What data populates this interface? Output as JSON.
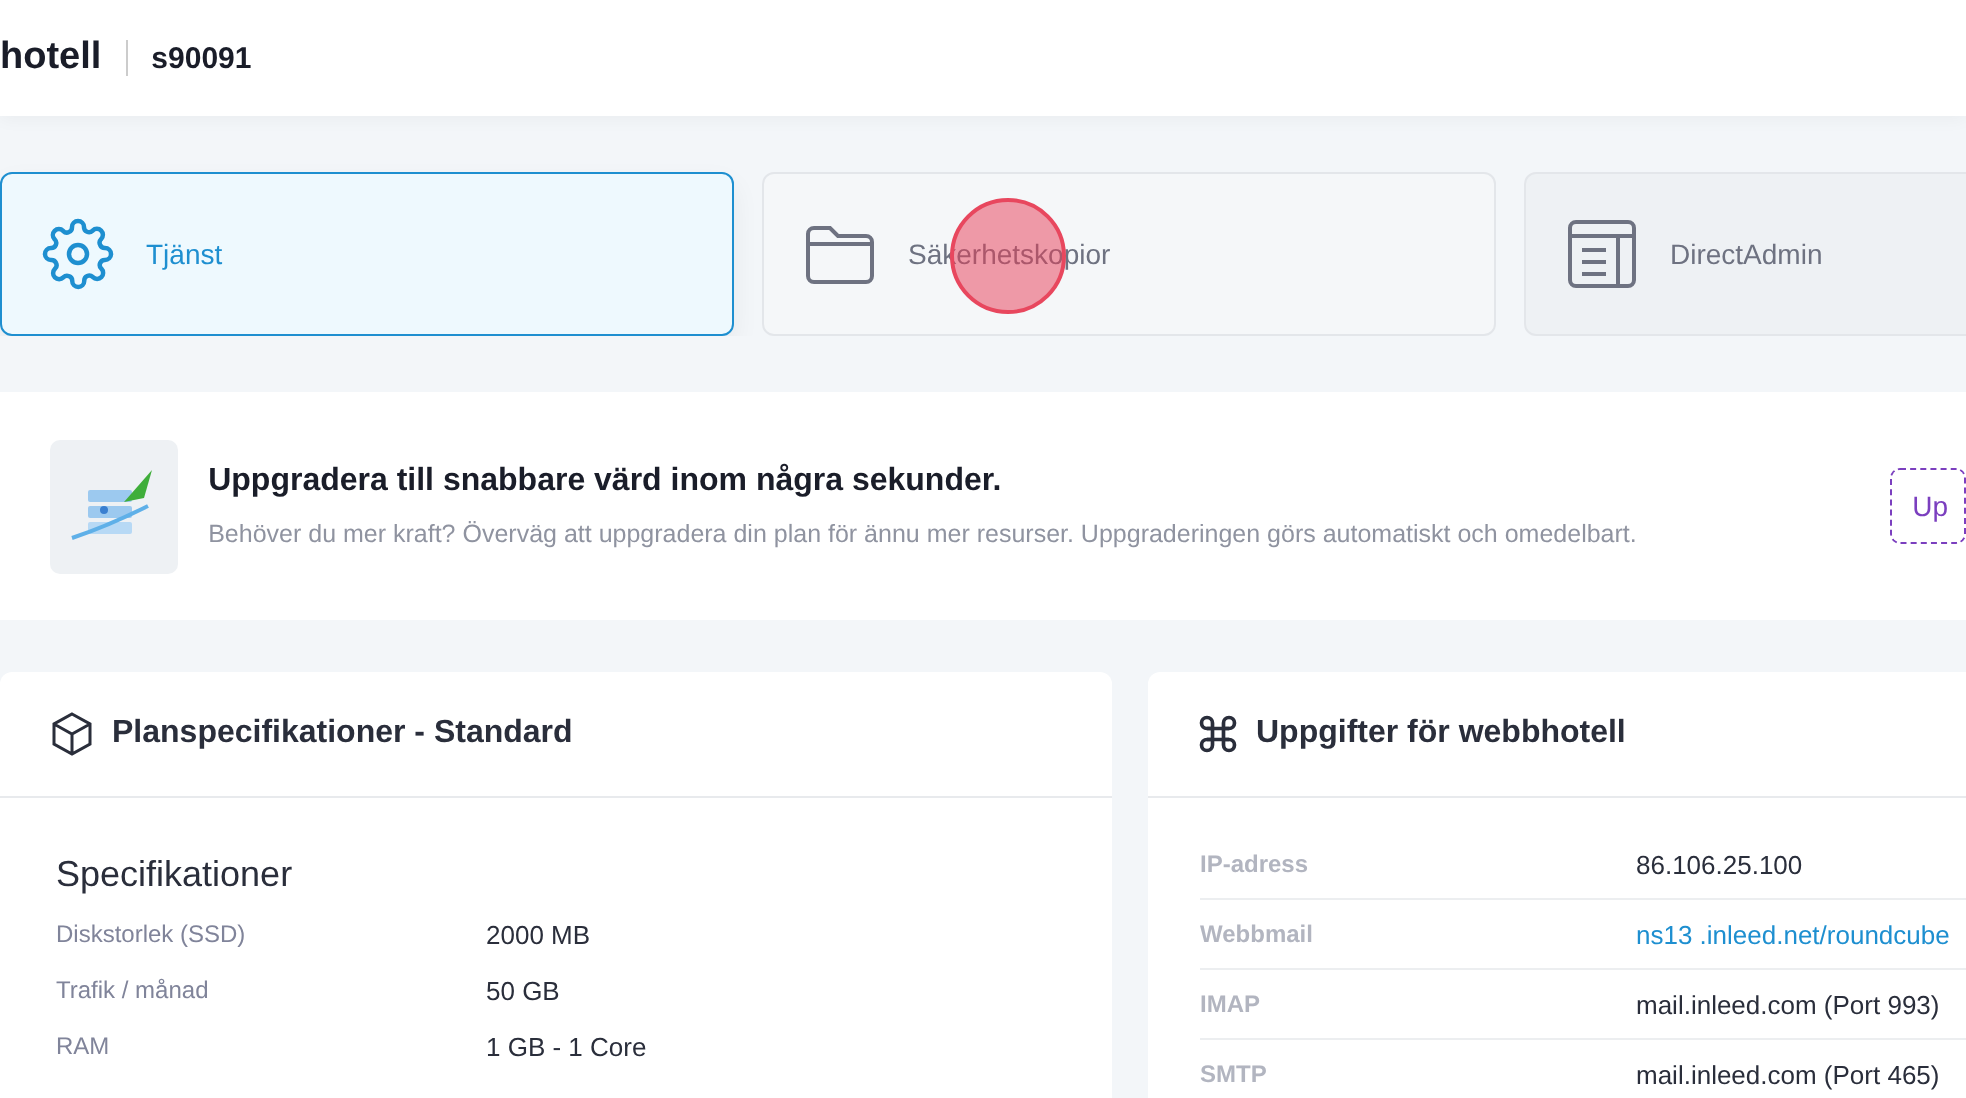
{
  "header": {
    "title": "hotell",
    "account": "s90091"
  },
  "tabs": [
    {
      "label": "Tjänst",
      "kind": "gear",
      "selected": true,
      "clicked": false
    },
    {
      "label": "Säkerhetskopior",
      "kind": "folder",
      "selected": false,
      "clicked": true
    },
    {
      "label": "DirectAdmin",
      "kind": "panel",
      "selected": false,
      "clicked": false
    }
  ],
  "upgrade_banner": {
    "title": "Uppgradera till snabbare värd inom några sekunder.",
    "text": "Behöver du mer kraft? Överväg att uppgradera din plan för ännu mer resurser. Uppgraderingen görs automatiskt och omedelbart.",
    "button": "Up"
  },
  "plan_card": {
    "title": "Planspecifikationer - Standard",
    "section": "Specifikationer",
    "rows": [
      {
        "label": "Diskstorlek (SSD)",
        "value": "2000 MB"
      },
      {
        "label": "Trafik / månad",
        "value": "50 GB"
      },
      {
        "label": "RAM",
        "value": "1 GB - 1 Core"
      }
    ]
  },
  "hosting_card": {
    "title": "Uppgifter för webbhotell",
    "rows": [
      {
        "label": "IP-adress",
        "value": "86.106.25.100",
        "kind": "text"
      },
      {
        "label": "Webbmail",
        "value": "ns13 .inleed.net/roundcube",
        "kind": "link"
      },
      {
        "label": "IMAP",
        "value": "mail.inleed.com (Port 993)",
        "kind": "text"
      },
      {
        "label": "SMTP",
        "value": "mail.inleed.com (Port 465)",
        "kind": "text"
      }
    ]
  }
}
